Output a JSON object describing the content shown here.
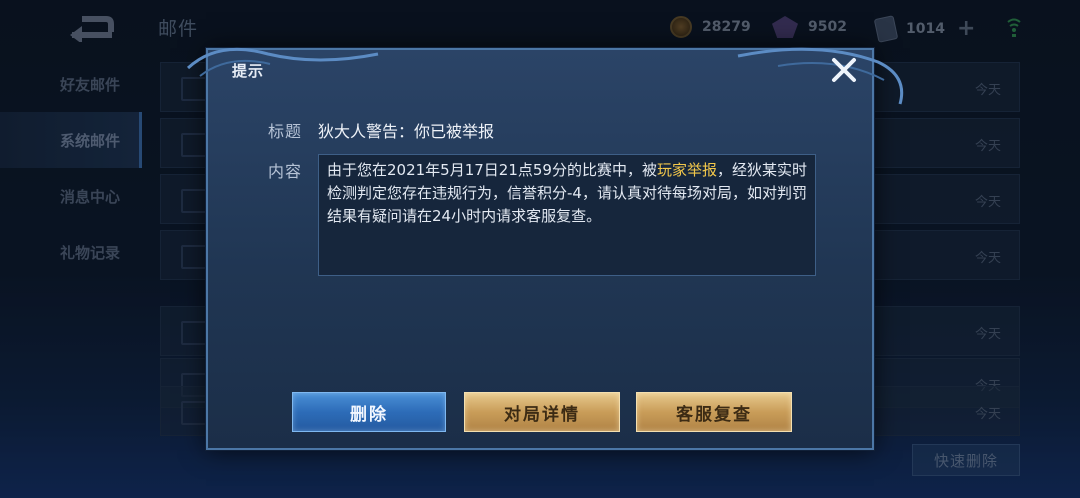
{
  "header": {
    "title": "邮件",
    "resources": [
      {
        "icon": "coin-icon",
        "value": "28279"
      },
      {
        "icon": "gem-icon",
        "value": "9502"
      },
      {
        "icon": "card-icon",
        "value": "1014"
      }
    ]
  },
  "sidebar": {
    "items": [
      {
        "label": "好友邮件",
        "active": false
      },
      {
        "label": "系统邮件",
        "active": true
      },
      {
        "label": "消息中心",
        "active": false
      },
      {
        "label": "礼物记录",
        "active": false
      }
    ]
  },
  "mail_list": {
    "rows": [
      {
        "date": "今天"
      },
      {
        "date": "今天"
      },
      {
        "date": "今天"
      },
      {
        "date": "今天"
      },
      {
        "date": "今天"
      },
      {
        "date": "今天"
      },
      {
        "date": "今天"
      }
    ],
    "quick_delete_label": "快速删除"
  },
  "dialog": {
    "title": "提示",
    "subject_label": "标题",
    "subject": "狄大人警告：你已被举报",
    "content_label": "内容",
    "content_pre": "由于您在2021年5月17日21点59分的比赛中，被",
    "content_highlight": "玩家举报",
    "content_post": "，经狄某实时检测判定您存在违规行为，信誉积分-4，请认真对待每场对局，如对判罚结果有疑问请在24小时内请求客服复查。",
    "highlight_color": "#f3c84b",
    "buttons": {
      "delete": "删除",
      "match_detail": "对局详情",
      "service_review": "客服复查"
    }
  }
}
